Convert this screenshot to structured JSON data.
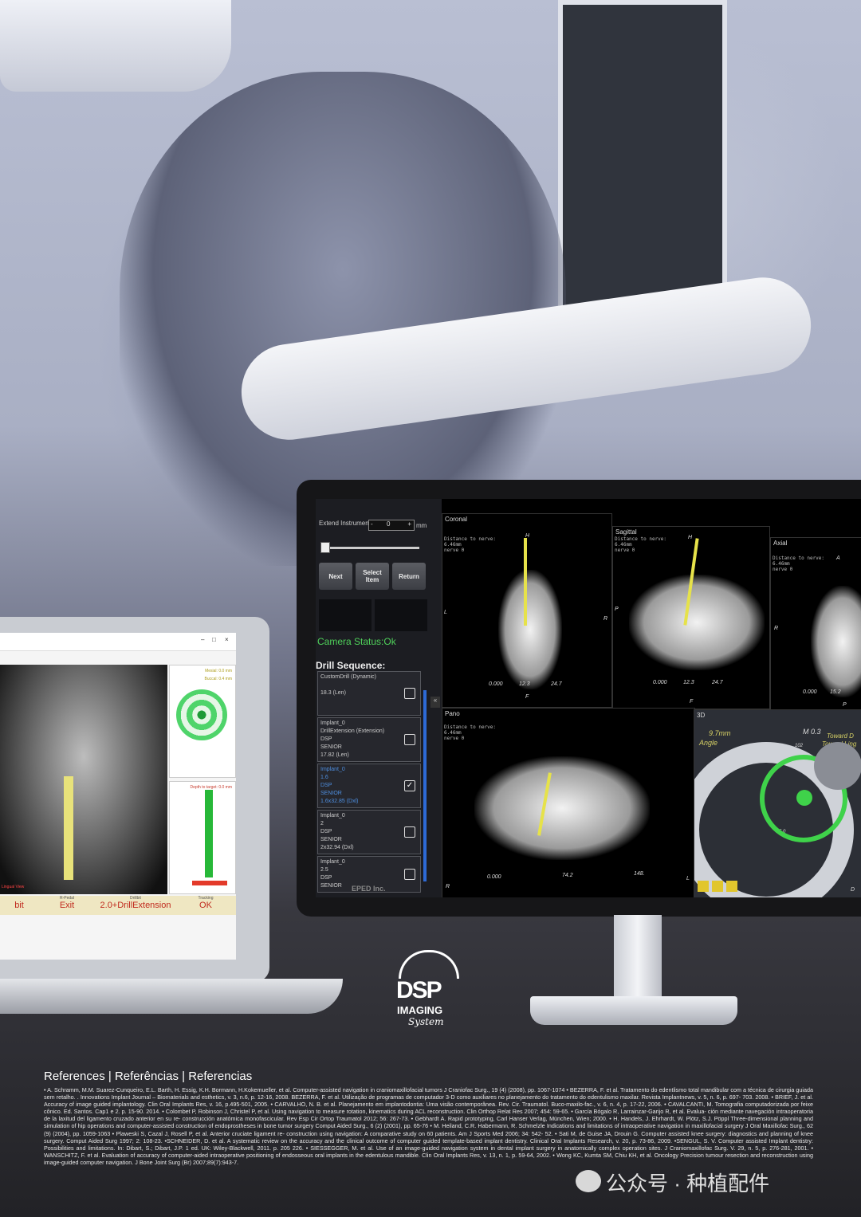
{
  "monitor": {
    "extend_label": "Extend Instrument",
    "extend_value": "0",
    "extend_unit": "mm",
    "minus": "-",
    "plus": "+",
    "buttons": [
      "Next",
      "Select Item",
      "Return"
    ],
    "camera_status": "Camera Status:Ok",
    "drill_heading": "Drill Sequence:",
    "collapse": "«",
    "drills": [
      {
        "lines": [
          "CustomDrill (Dynamic)",
          "",
          "18.3 (Len)"
        ],
        "checked": false
      },
      {
        "lines": [
          "Implant_0",
          "DrillExtension (Extension)",
          "DSP",
          "SENIOR",
          "17.82 (Len)"
        ],
        "checked": false
      },
      {
        "lines": [
          "Implant_0",
          "1.6",
          "DSP",
          "SENIOR",
          "1.6x32.85 (Dxl)"
        ],
        "checked": true
      },
      {
        "lines": [
          "Implant_0",
          "2",
          "DSP",
          "SENIOR",
          "2x32.94 (Dxl)"
        ],
        "checked": false
      },
      {
        "lines": [
          "Implant_0",
          "2.5",
          "DSP",
          "SENIOR"
        ],
        "checked": false
      }
    ],
    "check_mark": "✓",
    "vendor": "EPED Inc.",
    "views": {
      "coronal": {
        "label": "Coronal",
        "note": [
          "Distance to nerve:",
          "6.46mm",
          "nerve 0"
        ],
        "top": "H",
        "left": "L",
        "right": "R",
        "bottom": "F",
        "ticks": [
          "0.000",
          "12.3",
          "24.7"
        ]
      },
      "sagittal": {
        "label": "Sagittal",
        "note": [
          "Distance to nerve:",
          "6.46mm",
          "nerve 0"
        ],
        "top": "H",
        "left": "P",
        "bottom": "F",
        "ticks": [
          "0.000",
          "12.3",
          "24.7"
        ]
      },
      "axial": {
        "label": "Axial",
        "note": [
          "Distance to nerve:",
          "6.46mm",
          "nerve 0"
        ],
        "top": "A",
        "left": "R",
        "bottom": "P",
        "ticks": [
          "0.000",
          "15.2"
        ]
      },
      "pano": {
        "label": "Pano",
        "note": [
          "Distance to nerve:",
          "6.46mm",
          "nerve 0"
        ],
        "left": "R",
        "right": "L",
        "ticks": [
          "0.000",
          "74.2",
          "148."
        ]
      },
      "threed": {
        "label": "3D",
        "readout": "9.7mm",
        "angle": "Angle",
        "m": "M",
        "d": "D",
        "depth": "0.3",
        "toward1": "Toward D",
        "toward2": "Toward Ling",
        "small": [
          "96",
          "102",
          "5.0"
        ]
      }
    }
  },
  "laptop": {
    "title_buttons": [
      "–",
      "□",
      "×"
    ],
    "mesial": "Mesial: 0.0 mm",
    "buccal": "Buccal: 0.4 mm",
    "depth": "Depth to target: 0.0 mm",
    "view_caption": "Lingual View",
    "footer": [
      {
        "small": "",
        "value": "bit"
      },
      {
        "small": "R-Pedal",
        "value": "Exit"
      },
      {
        "small": "Drillbit",
        "value": "2.0+DrillExtension"
      },
      {
        "small": "Tracking",
        "value": "OK"
      }
    ]
  },
  "logo": {
    "line1": "DSP",
    "line2": "IMAGING",
    "line3": "System"
  },
  "references": {
    "heading": "References | Referências | Referencias",
    "body": "• A. Schramm, M.M. Suarez-Cunqueiro, E.L. Barth, H. Essig, K.H. Bormann, H.Kokemueller, et al. Computer-assisted navigation in craniomaxillofacial tumors J Craniofac Surg., 19 (4) (2008), pp. 1067-1074 • BEZERRA, F. et al. Tratamento do edentlismo total mandibular com a técnica de cirurgia guiada sem retalho. . Innovations Implant Journal – Biomaterials and esthetics, v. 3, n.6, p. 12-16, 2008. BEZERRA, F. et al. Utilização de programas de computador 3-D como auxiliares no planejamento do tratamento do edentulismo maxilar. Revista Implantnews, v. 5, n. 6, p. 697- 703. 2008. • BRIEF, J. et al. Accuracy of image guided implantology. Clin Oral Implants Res, v. 16, p.495-501, 2005. • CARVALHO, N. B. et al. Planejamento em implantodontia: Uma visão contemporânea. Rev. Cir. Traumatol. Buco-maxilo-fac., v. 6, n. 4, p. 17-22, 2006. • CAVALCANTI, M. Tomografia computadorizada por feixe cônico. Ed. Santos. Cap1 e 2. p. 15-90. 2014. • Colombet P, Robinson J, Christel P, et al. Using navigation to measure rotation, kinematics during ACL reconstruction. Clin Orthop Relat Res 2007; 454: 59-65. • García Bógalo R, Larrainzar-Garijo R, et al. Evalua- ción mediante navegación intraoperatoria de la laxitud del ligamento cruzado anterior en su re- construcción anatómica monofascicular. Rev Esp Cir Ortop Traumatol 2012; 56: 267-73. • Gebhardt A. Rapid prototyping, Carl Hanser Verlag, München, Wien; 2000. • H. Handels, J. Ehrhardt, W. Plötz, S.J. Pöppl Three-dimensional planning and simulation of hip operations and computer-assisted construction of endoprostheses in bone tumor surgery Comput Aided Surg., 6 (2) (2001), pp. 65-76 • M. Heiland, C.R. Habermann, R. Schmelzle Indications and limitations of intraoperative navigation in maxillofacial surgery J Oral Maxillofac Surg., 62 (9) (2004), pp. 1059-1063 • Plaweski S, Cazal J, Rosell P, et al. Anterior cruciate ligament re- construction using navigation: A comparative study on 60 patients. Am J Sports Med 2006; 34: 542- 52. • Sati M, de Guise JA, Drouin G. Computer assisted knee surgery: diagnostics and planning of knee surgery. Comput Aided Surg 1997; 2: 108-23. •SCHNEIDER, D. et al. A systematic review on the accuracy and the clinical outcome of computer guided template-based implant dentistry. Clinical Oral Implants Research, v. 20, p. 73-86, 2009. •SENGUL, S. V. Computer assisted Implant dentistry: Possibilities and limitations. In: Dibart, S.; Dibart, J.P. 1 ed. UK: Wiley-Blackwell, 2011. p. 205 226. • SIESSEGGER, M. et al. Use of an image-guided navigation system in dental implant surgery in anatomically complex operation sites. J Craniomaxillofac Surg. V. 29, n. 5, p. 276-281, 2001. • WANSCHITZ, F. et al. Evaluation of accuracy of computer-aided intraoperative positioning of endosseous oral implants in the edentulous mandible. Clin Oral Implants Res, v. 13, n. 1, p. 59-64, 2002. • Wong KC, Kumta SM, Chiu KH, et al. Oncology Precision tumour resection and reconstruction using image-guided computer navigation. J Bone Joint Surg (Br) 2007;89(7):943-7."
  },
  "watermark": "公众号 · 种植配件"
}
